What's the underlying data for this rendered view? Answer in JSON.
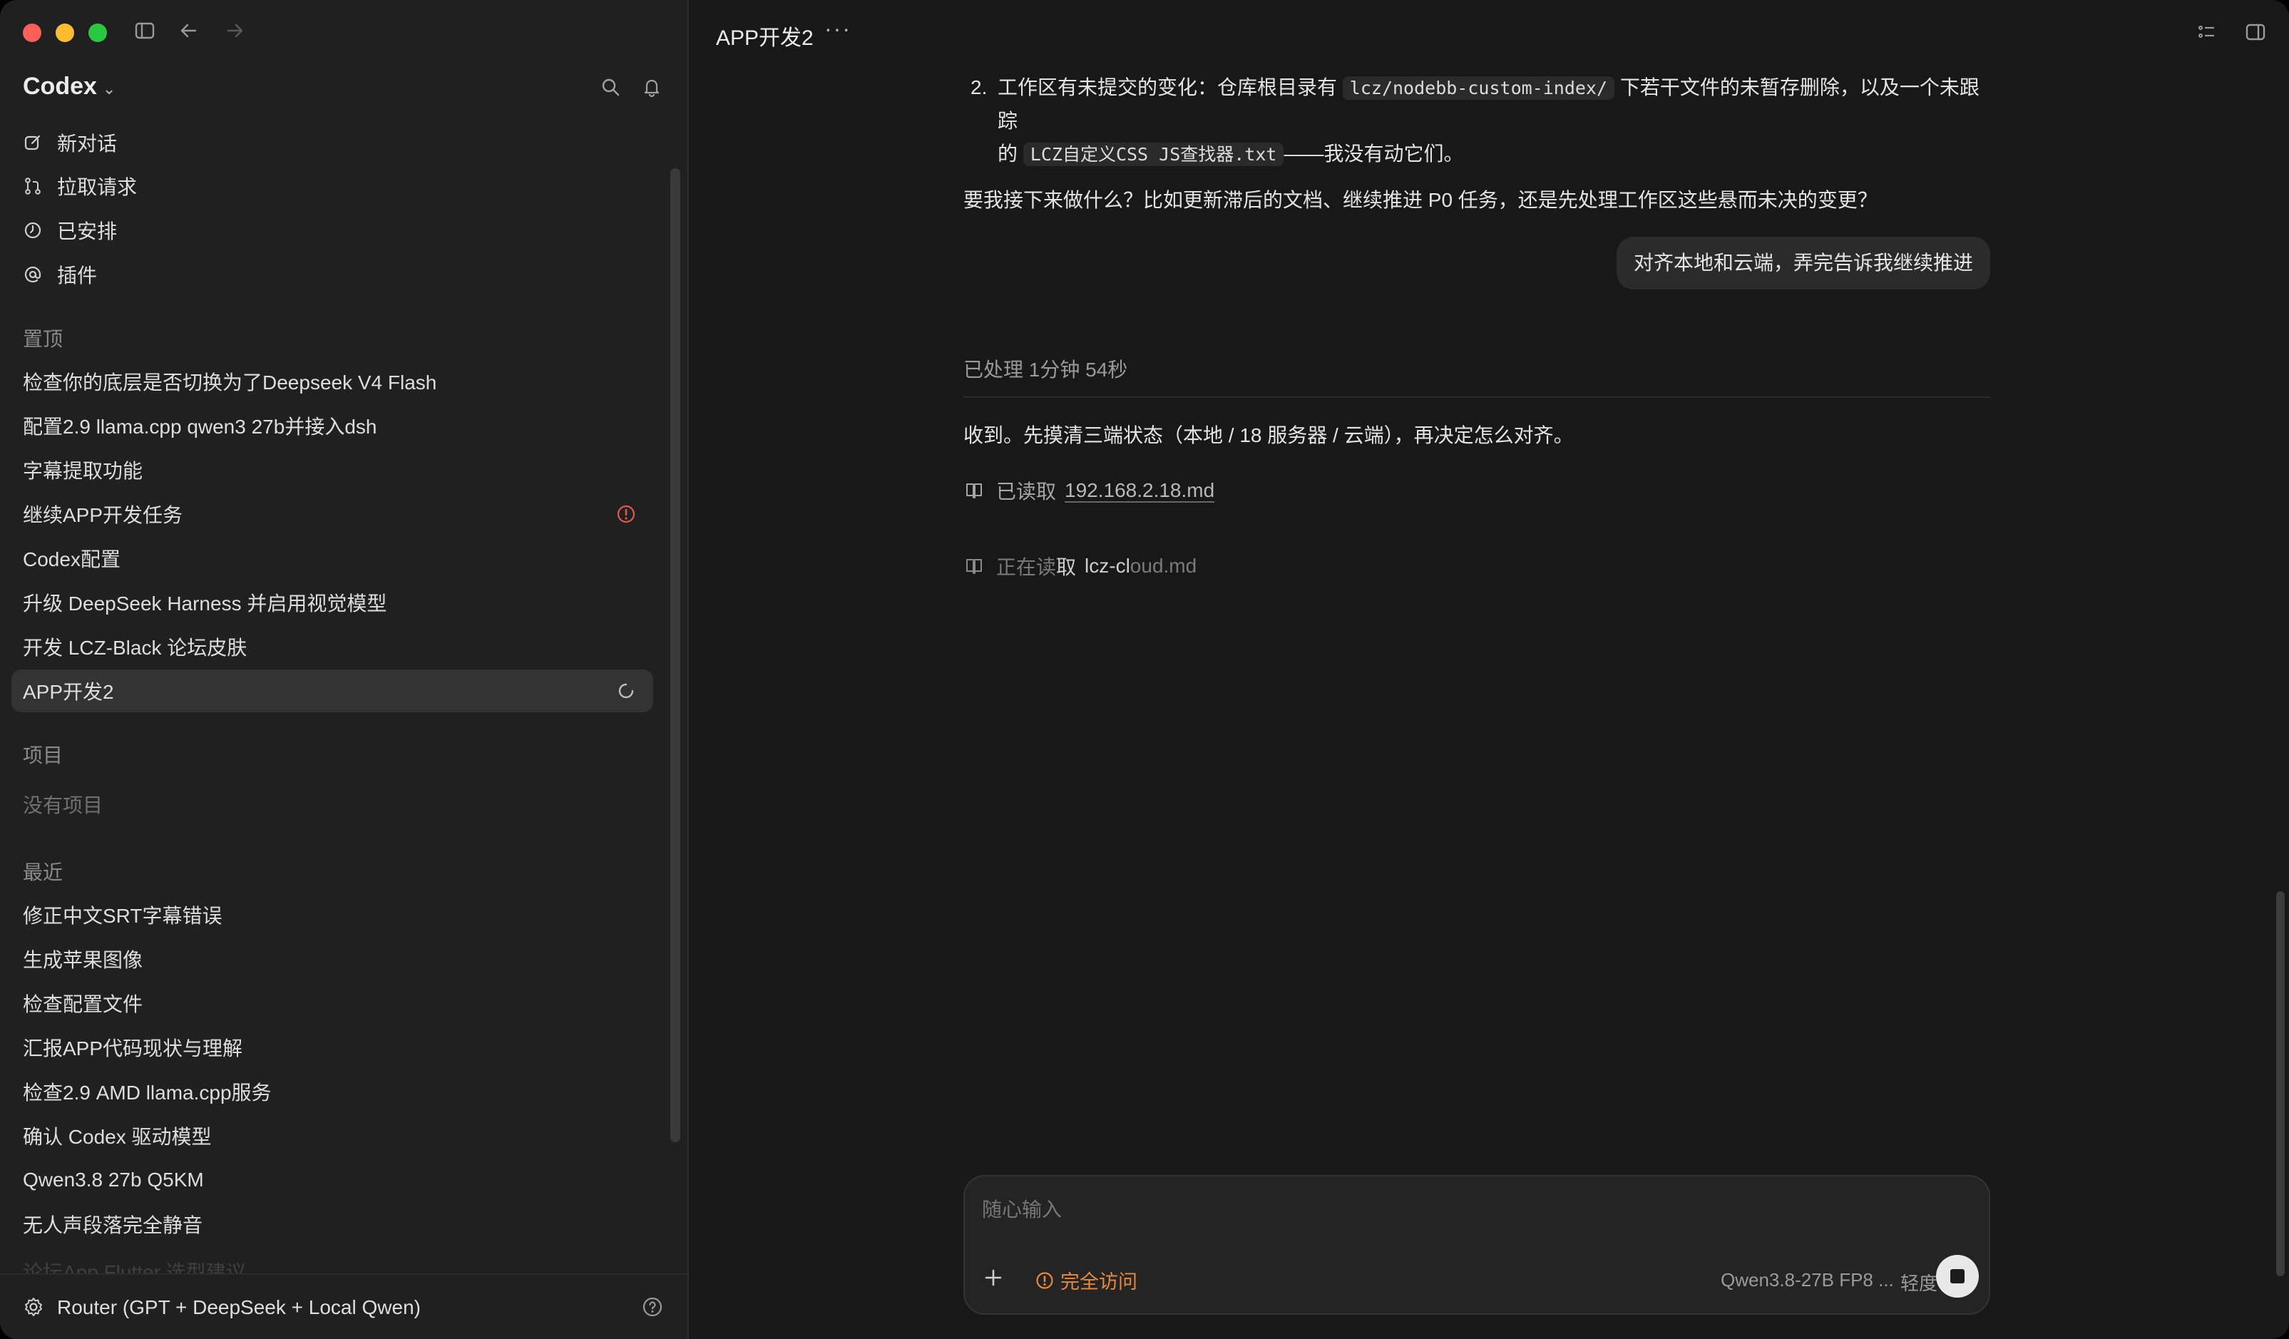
{
  "sidebar": {
    "brand": "Codex",
    "nav": [
      {
        "label": "新对话",
        "icon": "new-chat-icon"
      },
      {
        "label": "拉取请求",
        "icon": "pull-request-icon"
      },
      {
        "label": "已安排",
        "icon": "clock-icon"
      },
      {
        "label": "插件",
        "icon": "at-icon"
      }
    ],
    "pinned_label": "置顶",
    "pinned": [
      "检查你的底层是否切换为了Deepseek V4 Flash",
      "配置2.9 llama.cpp qwen3 27b并接入dsh",
      "字幕提取功能",
      "继续APP开发任务",
      "Codex配置",
      "升级 DeepSeek Harness 并启用视觉模型",
      "开发 LCZ-Black 论坛皮肤",
      "APP开发2"
    ],
    "projects_label": "项目",
    "no_projects": "没有项目",
    "recent_label": "最近",
    "recent": [
      "修正中文SRT字幕错误",
      "生成苹果图像",
      "检查配置文件",
      "汇报APP代码现状与理解",
      "检查2.9 AMD llama.cpp服务",
      "确认 Codex 驱动模型",
      "Qwen3.8 27b Q5KM",
      "无人声段落完全静音",
      "论坛App Flutter 选型建议"
    ],
    "footer": "Router (GPT + DeepSeek + Local Qwen)"
  },
  "main": {
    "title": "APP开发2",
    "msg": {
      "item_num": "2.",
      "line1_a": "工作区有未提交的变化：仓库根目录有",
      "code1": "lcz/nodebb-custom-index/",
      "line1_b": "下若干文件的未暂存删除，以及一个未跟踪",
      "line2_a": "的",
      "code2": "LCZ自定义CSS JS查找器.txt",
      "line2_b": "——我没有动它们。",
      "question": "要我接下来做什么？比如更新滞后的文档、继续推进 P0 任务，还是先处理工作区这些悬而未决的变更？"
    },
    "user_bubble": "对齐本地和云端，弄完告诉我继续推进",
    "processed": "已处理 1分钟 54秒",
    "response": "收到。先摸清三端状态（本地 / 18 服务器 / 云端），再决定怎么对齐。",
    "read_done_label": "已读取",
    "read_done_file": "192.168.2.18.md",
    "reading_label_a": "正在读",
    "reading_label_b": "取",
    "reading_file_a": "lcz-cl",
    "reading_file_b": "oud.md"
  },
  "composer": {
    "placeholder": "随心输入",
    "access": "完全访问",
    "model": "Qwen3.8-27B FP8 ...",
    "effort": "轻度"
  },
  "colors": {
    "accent_orange": "#e8893c",
    "badge_red": "#e05a4a"
  }
}
